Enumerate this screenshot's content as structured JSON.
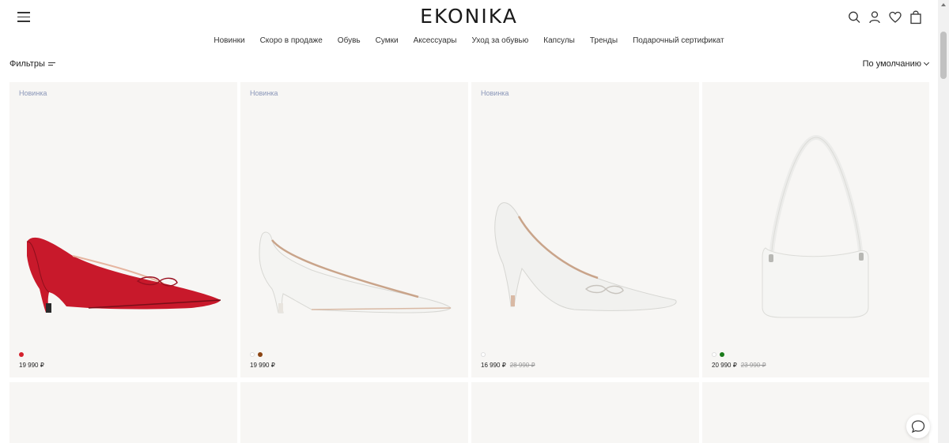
{
  "header": {
    "logo": "EKONIKA",
    "icons": [
      "search-icon",
      "user-icon",
      "heart-icon",
      "bag-icon"
    ]
  },
  "nav": {
    "items": [
      {
        "label": "Новинки"
      },
      {
        "label": "Скоро в продаже"
      },
      {
        "label": "Обувь"
      },
      {
        "label": "Сумки"
      },
      {
        "label": "Аксессуары"
      },
      {
        "label": "Уход за обувью"
      },
      {
        "label": "Капсулы"
      },
      {
        "label": "Тренды"
      },
      {
        "label": "Подарочный сертификат"
      }
    ]
  },
  "toolbar": {
    "filters_label": "Фильтры",
    "sort_label": "По умолчанию"
  },
  "products": [
    {
      "badge": "Новинка",
      "price": "19 990 ₽",
      "old_price": "",
      "colors": [
        "#d4202c"
      ]
    },
    {
      "badge": "Новинка",
      "price": "19 990 ₽",
      "old_price": "",
      "colors": [
        "#ffffff",
        "#8b4513"
      ]
    },
    {
      "badge": "Новинка",
      "price": "16 990 ₽",
      "old_price": "28 990 ₽",
      "colors": [
        "#ffffff"
      ]
    },
    {
      "badge": "",
      "price": "20 990 ₽",
      "old_price": "23 990 ₽",
      "colors": [
        "#ffffff",
        "#1a7a1a"
      ]
    }
  ],
  "colors": {
    "badge": "#8a96b8",
    "card_bg": "#f7f6f4"
  }
}
